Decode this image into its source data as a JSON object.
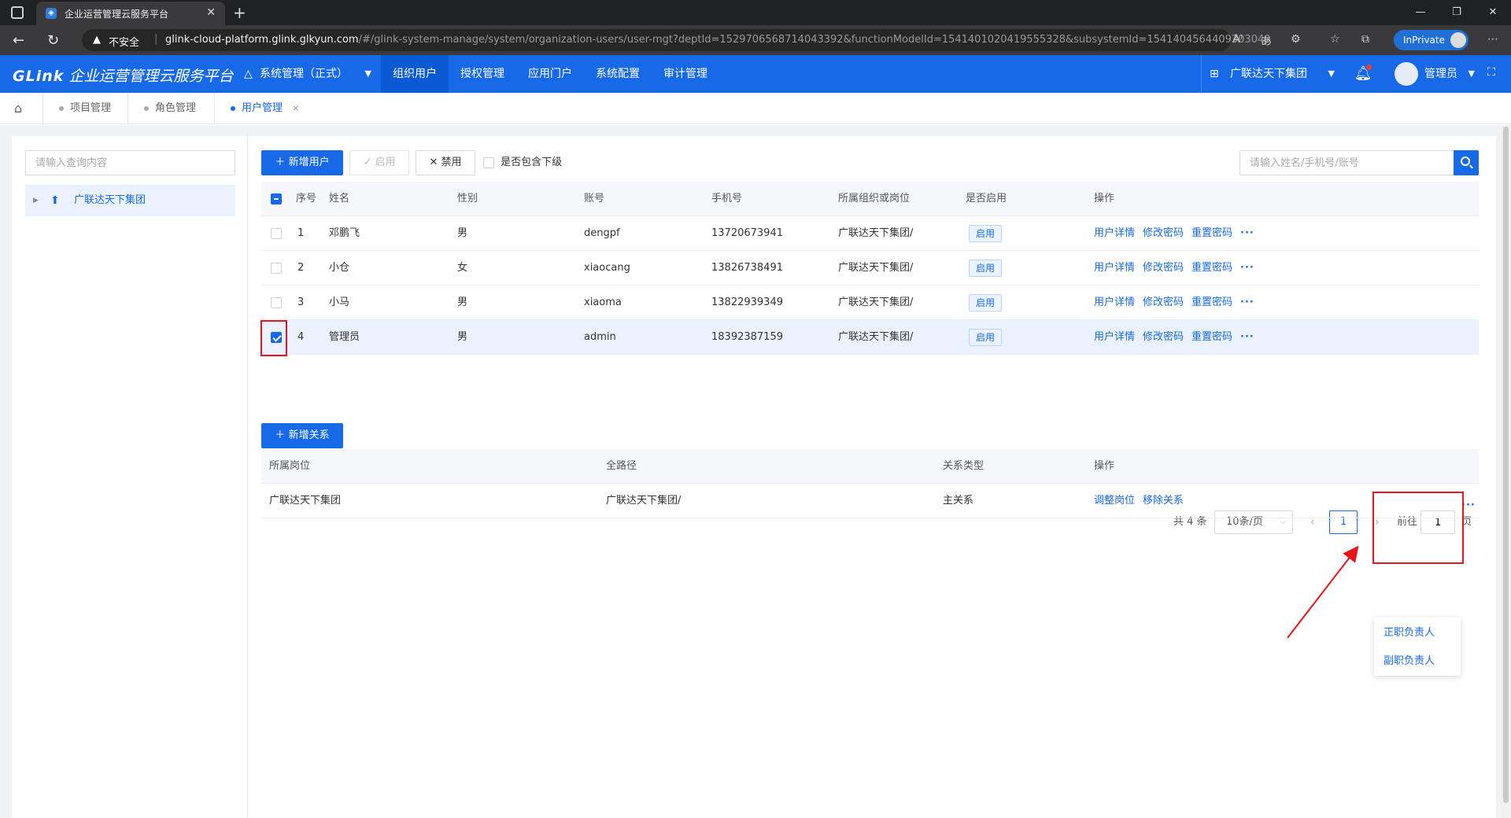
{
  "browser": {
    "tab_title": "企业运营管理云服务平台",
    "insecure_label": "不安全",
    "url_host": "glink-cloud-platform.glink.glkyun.com",
    "url_path": "/#/glink-system-manage/system/organization-users/user-mgt?deptId=1529706568714043392&functionModelId=1541401020419555328&subsystemId=1541404564409303040",
    "inprivate_label": "InPrivate"
  },
  "header": {
    "brand": "GLink",
    "platform_name": "企业运营管理云服务平台",
    "subsystem": "系统管理（正式）",
    "nav": [
      {
        "label": "组织用户",
        "active": true
      },
      {
        "label": "授权管理",
        "active": false
      },
      {
        "label": "应用门户",
        "active": false
      },
      {
        "label": "系统配置",
        "active": false
      },
      {
        "label": "审计管理",
        "active": false
      }
    ],
    "org": "广联达天下集团",
    "user": "管理员"
  },
  "breadcrumbs": [
    {
      "label": "项目管理",
      "active": false
    },
    {
      "label": "角色管理",
      "active": false
    },
    {
      "label": "用户管理",
      "active": true,
      "close": "×"
    }
  ],
  "tree": {
    "search_placeholder": "请输入查询内容",
    "root_label": "广联达天下集团"
  },
  "toolbar": {
    "add_user": "新增用户",
    "enable": "启用",
    "disable": "禁用",
    "include_sub": "是否包含下级",
    "search_placeholder": "请输入姓名/手机号/账号"
  },
  "user_table": {
    "columns": [
      "序号",
      "姓名",
      "性别",
      "账号",
      "手机号",
      "所属组织或岗位",
      "是否启用",
      "操作"
    ],
    "rows": [
      {
        "no": "1",
        "name": "邓鹏飞",
        "gender": "男",
        "account": "dengpf",
        "phone": "13720673941",
        "org": "广联达天下集团/",
        "status": "启用",
        "checked": false
      },
      {
        "no": "2",
        "name": "小仓",
        "gender": "女",
        "account": "xiaocang",
        "phone": "13826738491",
        "org": "广联达天下集团/",
        "status": "启用",
        "checked": false
      },
      {
        "no": "3",
        "name": "小马",
        "gender": "男",
        "account": "xiaoma",
        "phone": "13822939349",
        "org": "广联达天下集团/",
        "status": "启用",
        "checked": false
      },
      {
        "no": "4",
        "name": "管理员",
        "gender": "男",
        "account": "admin",
        "phone": "18392387159",
        "org": "广联达天下集团/",
        "status": "启用",
        "checked": true
      }
    ],
    "actions": [
      "用户详情",
      "修改密码",
      "重置密码"
    ],
    "more": "···"
  },
  "pagination": {
    "total": "共 4 条",
    "page_size": "10条/页",
    "current": "1",
    "goto_label": "前往",
    "goto_value": "1",
    "page_unit": "页"
  },
  "relation": {
    "add_button": "新增关系",
    "columns": [
      "所属岗位",
      "全路径",
      "关系类型",
      "操作"
    ],
    "rows": [
      {
        "post": "广联达天下集团",
        "path": "广联达天下集团/",
        "type": "主关系"
      }
    ],
    "actions": [
      "调整岗位",
      "移除关系"
    ],
    "more": "···"
  },
  "dropdown": {
    "items": [
      "正职负责人",
      "副职负责人"
    ]
  },
  "colors": {
    "primary": "#1769e8",
    "annotation_red": "#e8141b"
  }
}
